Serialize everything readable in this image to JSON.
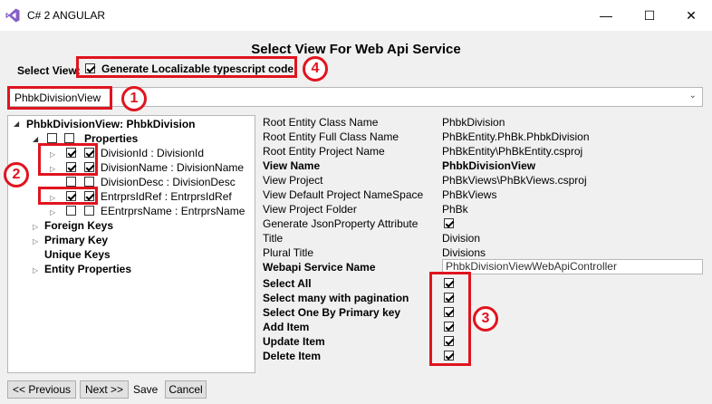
{
  "window": {
    "title": "C# 2 ANGULAR",
    "minimize": "—",
    "maximize": "☐",
    "close": "✕"
  },
  "heading": "Select View For Web Api Service",
  "select_view_label": "Select View:",
  "generate_localizable": {
    "label": "Generate Localizable typescript code",
    "checked": true
  },
  "view_combo": {
    "value": "PhbkDivisionView"
  },
  "tree": {
    "root": "PhbkDivisionView: PhbkDivision",
    "properties_label": "Properties",
    "items": [
      {
        "label": "DivisionId : DivisionId",
        "checked1": true,
        "checked2": true
      },
      {
        "label": "DivisionName : DivisionName",
        "checked1": true,
        "checked2": true
      },
      {
        "label": "DivisionDesc : DivisionDesc",
        "checked1": false,
        "checked2": false
      },
      {
        "label": "EntrprsIdRef : EntrprsIdRef",
        "checked1": true,
        "checked2": true
      },
      {
        "label": "EEntrprsName : EntrprsName",
        "checked1": false,
        "checked2": false
      }
    ],
    "foreign_keys": "Foreign Keys",
    "primary_key": "Primary Key",
    "unique_keys": "Unique Keys",
    "entity_properties": "Entity Properties"
  },
  "properties": [
    {
      "name": "Root Entity Class Name",
      "value": "PhbkDivision",
      "bold": false
    },
    {
      "name": "Root Entity Full Class Name",
      "value": "PhBkEntity.PhBk.PhbkDivision",
      "bold": false
    },
    {
      "name": "Root Entity Project Name",
      "value": "PhBkEntity\\PhBkEntity.csproj",
      "bold": false
    },
    {
      "name": "View Name",
      "value": "PhbkDivisionView",
      "bold": true
    },
    {
      "name": "View Project",
      "value": "PhBkViews\\PhBkViews.csproj",
      "bold": false
    },
    {
      "name": "View Default Project NameSpace",
      "value": "PhBkViews",
      "bold": false
    },
    {
      "name": "View Project Folder",
      "value": "PhBk",
      "bold": false
    },
    {
      "name": "Generate JsonProperty Attribute",
      "value": "",
      "bold": false
    },
    {
      "name": "Title",
      "value": "Division",
      "bold": false
    },
    {
      "name": "Plural Title",
      "value": "Divisions",
      "bold": false
    }
  ],
  "webapi_service_name": {
    "label": "Webapi Service Name",
    "value": "PhbkDivisionViewWebApiController"
  },
  "methods": [
    {
      "label": "Select All",
      "checked": true
    },
    {
      "label": "Select many with pagination",
      "checked": true
    },
    {
      "label": "Select One By Primary key",
      "checked": true
    },
    {
      "label": "Add Item",
      "checked": true
    },
    {
      "label": "Update Item",
      "checked": true
    },
    {
      "label": "Delete Item",
      "checked": true
    }
  ],
  "buttons": {
    "previous": "<< Previous",
    "next": "Next >>",
    "save": "Save",
    "cancel": "Cancel"
  },
  "badges": {
    "b1": "1",
    "b2": "2",
    "b3": "3",
    "b4": "4"
  },
  "colors": {
    "annotation_red": "#e0141e",
    "vs_purple": "#865fc5"
  }
}
